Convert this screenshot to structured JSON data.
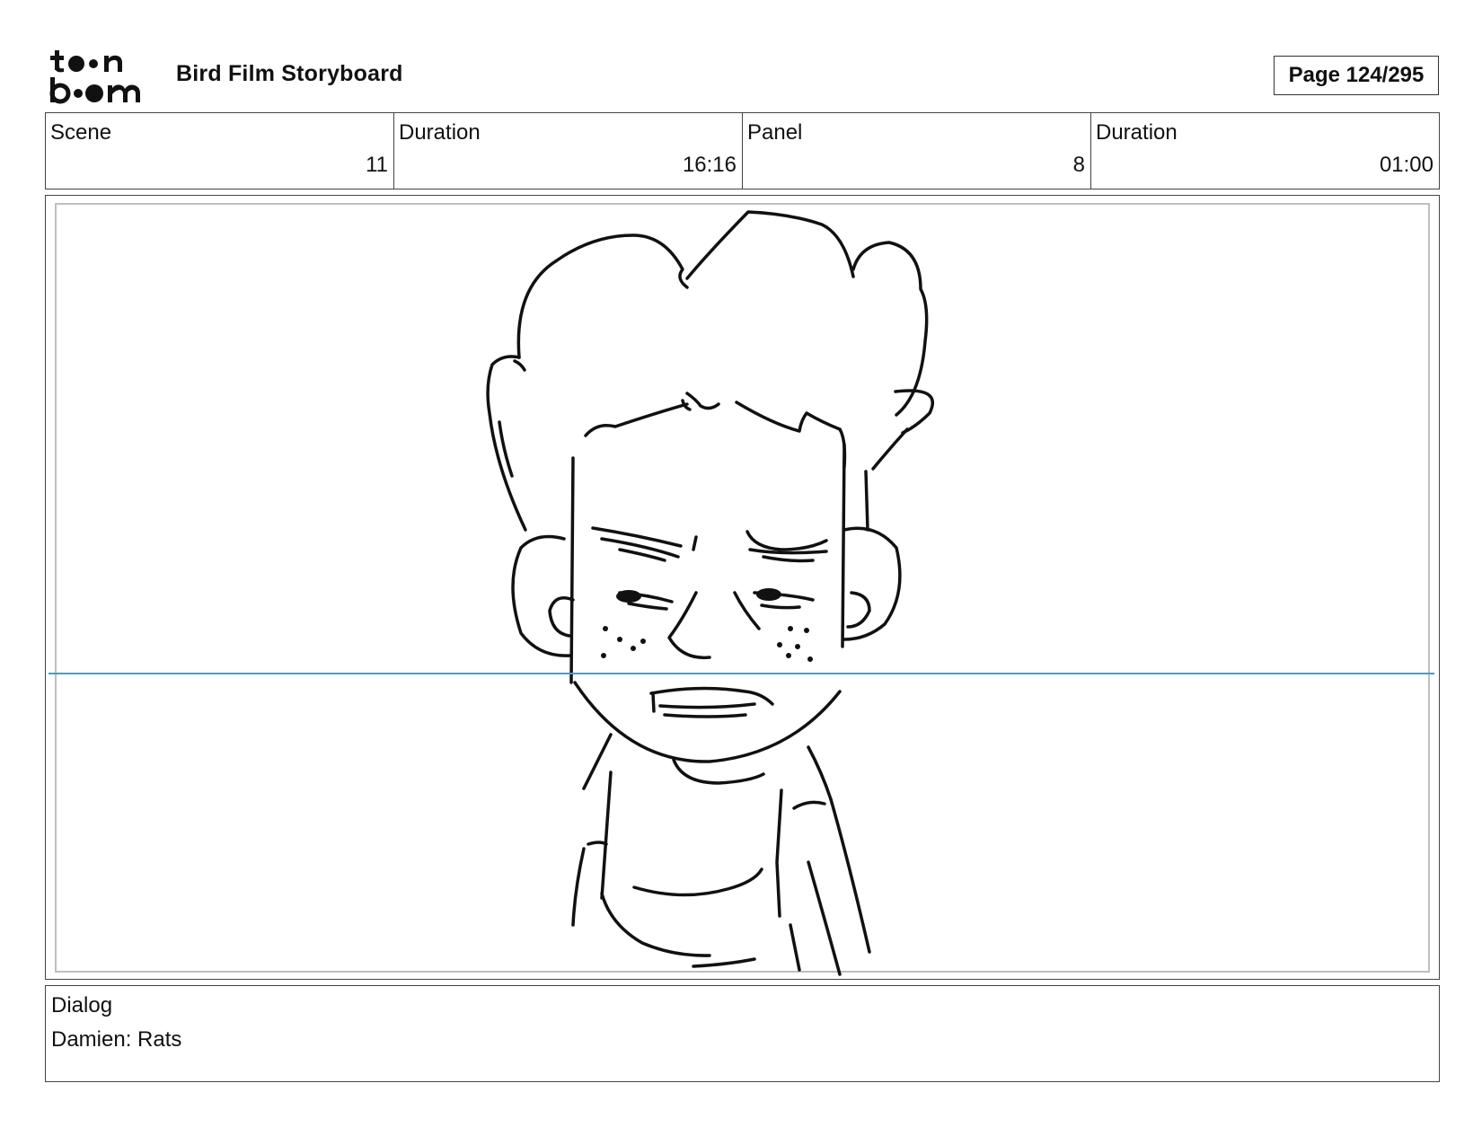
{
  "header": {
    "logo": {
      "top_text": "toon",
      "bottom_text": "boom",
      "icon": "toon-boom-logo"
    },
    "title": "Bird Film Storyboard",
    "page_indicator": "Page 124/295"
  },
  "info": [
    {
      "label": "Scene",
      "value": "11"
    },
    {
      "label": "Duration",
      "value": "16:16"
    },
    {
      "label": "Panel",
      "value": "8"
    },
    {
      "label": "Duration",
      "value": "01:00"
    }
  ],
  "panel": {
    "sketch_icon": "character-sketch-icon",
    "horizon_color": "#3aa0d8"
  },
  "dialog": {
    "label": "Dialog",
    "text": "Damien: Rats"
  }
}
